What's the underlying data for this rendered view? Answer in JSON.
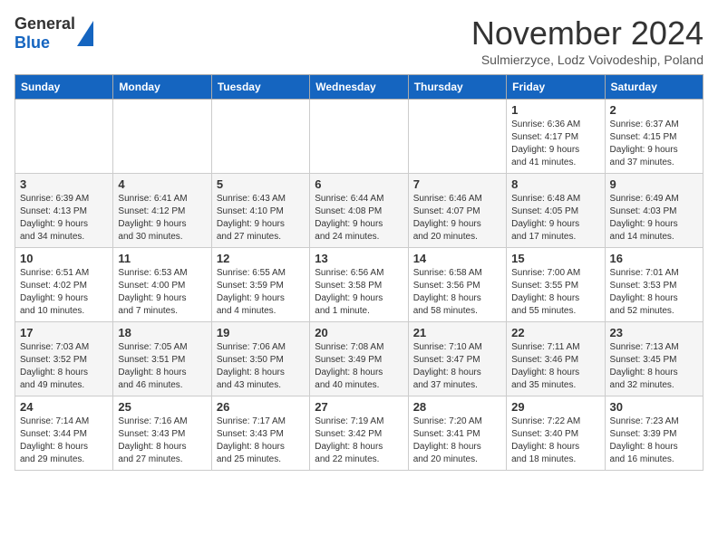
{
  "header": {
    "logo_general": "General",
    "logo_blue": "Blue",
    "month_title": "November 2024",
    "subtitle": "Sulmierzyce, Lodz Voivodeship, Poland"
  },
  "calendar": {
    "days_of_week": [
      "Sunday",
      "Monday",
      "Tuesday",
      "Wednesday",
      "Thursday",
      "Friday",
      "Saturday"
    ],
    "weeks": [
      [
        {
          "day": "",
          "info": ""
        },
        {
          "day": "",
          "info": ""
        },
        {
          "day": "",
          "info": ""
        },
        {
          "day": "",
          "info": ""
        },
        {
          "day": "",
          "info": ""
        },
        {
          "day": "1",
          "info": "Sunrise: 6:36 AM\nSunset: 4:17 PM\nDaylight: 9 hours\nand 41 minutes."
        },
        {
          "day": "2",
          "info": "Sunrise: 6:37 AM\nSunset: 4:15 PM\nDaylight: 9 hours\nand 37 minutes."
        }
      ],
      [
        {
          "day": "3",
          "info": "Sunrise: 6:39 AM\nSunset: 4:13 PM\nDaylight: 9 hours\nand 34 minutes."
        },
        {
          "day": "4",
          "info": "Sunrise: 6:41 AM\nSunset: 4:12 PM\nDaylight: 9 hours\nand 30 minutes."
        },
        {
          "day": "5",
          "info": "Sunrise: 6:43 AM\nSunset: 4:10 PM\nDaylight: 9 hours\nand 27 minutes."
        },
        {
          "day": "6",
          "info": "Sunrise: 6:44 AM\nSunset: 4:08 PM\nDaylight: 9 hours\nand 24 minutes."
        },
        {
          "day": "7",
          "info": "Sunrise: 6:46 AM\nSunset: 4:07 PM\nDaylight: 9 hours\nand 20 minutes."
        },
        {
          "day": "8",
          "info": "Sunrise: 6:48 AM\nSunset: 4:05 PM\nDaylight: 9 hours\nand 17 minutes."
        },
        {
          "day": "9",
          "info": "Sunrise: 6:49 AM\nSunset: 4:03 PM\nDaylight: 9 hours\nand 14 minutes."
        }
      ],
      [
        {
          "day": "10",
          "info": "Sunrise: 6:51 AM\nSunset: 4:02 PM\nDaylight: 9 hours\nand 10 minutes."
        },
        {
          "day": "11",
          "info": "Sunrise: 6:53 AM\nSunset: 4:00 PM\nDaylight: 9 hours\nand 7 minutes."
        },
        {
          "day": "12",
          "info": "Sunrise: 6:55 AM\nSunset: 3:59 PM\nDaylight: 9 hours\nand 4 minutes."
        },
        {
          "day": "13",
          "info": "Sunrise: 6:56 AM\nSunset: 3:58 PM\nDaylight: 9 hours\nand 1 minute."
        },
        {
          "day": "14",
          "info": "Sunrise: 6:58 AM\nSunset: 3:56 PM\nDaylight: 8 hours\nand 58 minutes."
        },
        {
          "day": "15",
          "info": "Sunrise: 7:00 AM\nSunset: 3:55 PM\nDaylight: 8 hours\nand 55 minutes."
        },
        {
          "day": "16",
          "info": "Sunrise: 7:01 AM\nSunset: 3:53 PM\nDaylight: 8 hours\nand 52 minutes."
        }
      ],
      [
        {
          "day": "17",
          "info": "Sunrise: 7:03 AM\nSunset: 3:52 PM\nDaylight: 8 hours\nand 49 minutes."
        },
        {
          "day": "18",
          "info": "Sunrise: 7:05 AM\nSunset: 3:51 PM\nDaylight: 8 hours\nand 46 minutes."
        },
        {
          "day": "19",
          "info": "Sunrise: 7:06 AM\nSunset: 3:50 PM\nDaylight: 8 hours\nand 43 minutes."
        },
        {
          "day": "20",
          "info": "Sunrise: 7:08 AM\nSunset: 3:49 PM\nDaylight: 8 hours\nand 40 minutes."
        },
        {
          "day": "21",
          "info": "Sunrise: 7:10 AM\nSunset: 3:47 PM\nDaylight: 8 hours\nand 37 minutes."
        },
        {
          "day": "22",
          "info": "Sunrise: 7:11 AM\nSunset: 3:46 PM\nDaylight: 8 hours\nand 35 minutes."
        },
        {
          "day": "23",
          "info": "Sunrise: 7:13 AM\nSunset: 3:45 PM\nDaylight: 8 hours\nand 32 minutes."
        }
      ],
      [
        {
          "day": "24",
          "info": "Sunrise: 7:14 AM\nSunset: 3:44 PM\nDaylight: 8 hours\nand 29 minutes."
        },
        {
          "day": "25",
          "info": "Sunrise: 7:16 AM\nSunset: 3:43 PM\nDaylight: 8 hours\nand 27 minutes."
        },
        {
          "day": "26",
          "info": "Sunrise: 7:17 AM\nSunset: 3:43 PM\nDaylight: 8 hours\nand 25 minutes."
        },
        {
          "day": "27",
          "info": "Sunrise: 7:19 AM\nSunset: 3:42 PM\nDaylight: 8 hours\nand 22 minutes."
        },
        {
          "day": "28",
          "info": "Sunrise: 7:20 AM\nSunset: 3:41 PM\nDaylight: 8 hours\nand 20 minutes."
        },
        {
          "day": "29",
          "info": "Sunrise: 7:22 AM\nSunset: 3:40 PM\nDaylight: 8 hours\nand 18 minutes."
        },
        {
          "day": "30",
          "info": "Sunrise: 7:23 AM\nSunset: 3:39 PM\nDaylight: 8 hours\nand 16 minutes."
        }
      ]
    ]
  }
}
